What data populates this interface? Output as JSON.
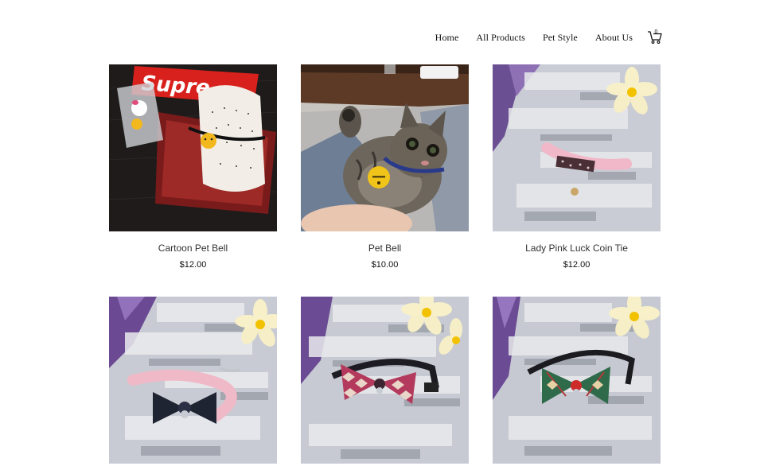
{
  "nav": {
    "home": "Home",
    "all_products": "All Products",
    "pet_style": "Pet Style",
    "about_us": "About Us",
    "cart_count": "0"
  },
  "products": [
    {
      "name": "Cartoon Pet Bell",
      "price": "$12.00",
      "brand_text": "Supre"
    },
    {
      "name": "Pet Bell",
      "price": "$10.00"
    },
    {
      "name": "Lady Pink Luck Coin Tie",
      "price": "$12.00"
    },
    {
      "name": "",
      "price": ""
    },
    {
      "name": "",
      "price": ""
    },
    {
      "name": "",
      "price": ""
    }
  ]
}
